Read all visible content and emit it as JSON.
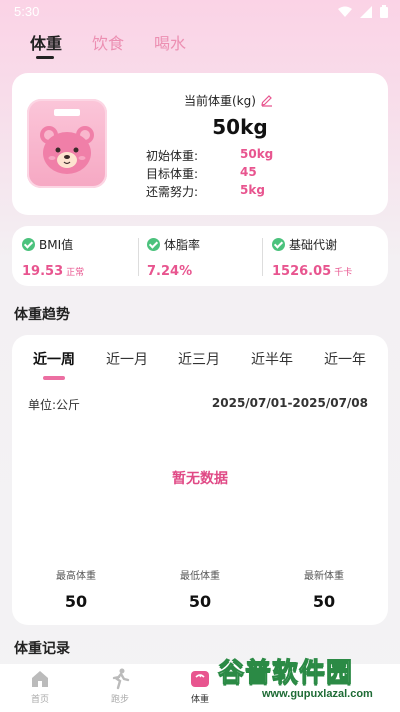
{
  "status_bar": {
    "time": "5:30"
  },
  "tabs": [
    {
      "label": "体重"
    },
    {
      "label": "饮食"
    },
    {
      "label": "喝水"
    }
  ],
  "current_weight": {
    "label": "当前体重(kg)",
    "value": "50kg",
    "rows": [
      {
        "label": "初始体重:",
        "value": "50kg"
      },
      {
        "label": "目标体重:",
        "value": "45"
      },
      {
        "label": "还需努力:",
        "value": "5kg"
      }
    ]
  },
  "stats": [
    {
      "label": "BMI值",
      "value": "19.53",
      "unit": "正常"
    },
    {
      "label": "体脂率",
      "value": "7.24%",
      "unit": ""
    },
    {
      "label": "基础代谢",
      "value": "1526.05",
      "unit": "千卡"
    }
  ],
  "trend": {
    "title": "体重趋势",
    "periods": [
      "近一周",
      "近一月",
      "近三月",
      "近半年",
      "近一年"
    ],
    "active_period": "近一周",
    "unit_label": "单位:公斤",
    "date_range": "2025/07/01-2025/07/08",
    "no_data": "暂无数据",
    "summary": [
      {
        "label": "最高体重",
        "value": "50"
      },
      {
        "label": "最低体重",
        "value": "50"
      },
      {
        "label": "最新体重",
        "value": "50"
      }
    ]
  },
  "records": {
    "title": "体重记录"
  },
  "bottom_nav": [
    {
      "label": "首页",
      "icon": "home-icon"
    },
    {
      "label": "跑步",
      "icon": "running-icon"
    },
    {
      "label": "体重",
      "icon": "scale-icon"
    }
  ],
  "watermark": {
    "title": "谷普软件园",
    "url": "www.gupuxlazal.com"
  },
  "colors": {
    "accent": "#e8558f",
    "check": "#4cc27d",
    "header_gradient_top": "#fbd3e6"
  }
}
